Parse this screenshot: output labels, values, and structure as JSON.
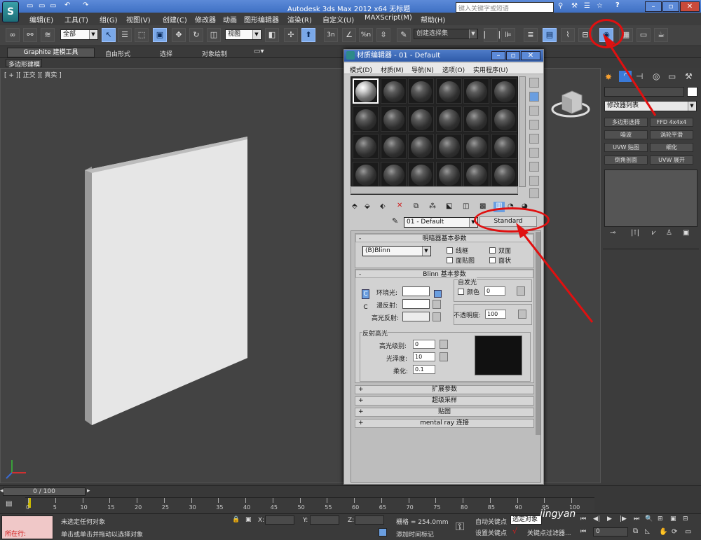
{
  "app": {
    "title": "Autodesk 3ds Max  2012 x64     无标题",
    "search_placeholder": "键入关键字或短语"
  },
  "menu": [
    "编辑(E)",
    "工具(T)",
    "组(G)",
    "视图(V)",
    "创建(C)",
    "修改器",
    "动画",
    "图形编辑器",
    "渲染(R)",
    "自定义(U)",
    "MAXScript(M)",
    "帮助(H)"
  ],
  "toolbar": {
    "selection_filter": "全部",
    "coord_system": "视图",
    "snap_label": "3n",
    "angle_label": "%n",
    "named_selection": "创建选择集"
  },
  "ribbon": {
    "tabs": [
      "Graphite 建模工具",
      "自由形式",
      "选择",
      "对象绘制"
    ],
    "sub_label": "多边形建模"
  },
  "viewport": {
    "label": "[ + ][ 正交 ][ 真实 ]"
  },
  "material_editor": {
    "title": "材质编辑器 - 01 - Default",
    "menu": [
      "模式(D)",
      "材质(M)",
      "导航(N)",
      "选项(O)",
      "实用程序(U)"
    ],
    "material_name": "01 - Default",
    "material_type": "Standard",
    "shader_rollout": {
      "title": "明暗器基本参数",
      "shader": "(B)Blinn",
      "options": [
        "线框",
        "双面",
        "面贴图",
        "面状"
      ]
    },
    "blinn_rollout": {
      "title": "Blinn 基本参数",
      "self_illum_title": "自发光",
      "self_illum_color_label": "颜色",
      "self_illum_value": "0",
      "ambient_label": "环境光:",
      "diffuse_label": "漫反射:",
      "specular_label": "高光反射:",
      "opacity_label": "不透明度:",
      "opacity_value": "100",
      "spec_title": "反射高光",
      "spec_level_label": "高光级别:",
      "spec_level_value": "0",
      "gloss_label": "光泽度:",
      "gloss_value": "10",
      "soften_label": "柔化:",
      "soften_value": "0.1"
    },
    "collapsed_rollouts": [
      "扩展参数",
      "超级采样",
      "贴图",
      "mental ray 连接"
    ],
    "lock_icon": "C",
    "lock_icon2": "C"
  },
  "command_panel": {
    "modifier_list": "修改器列表",
    "buttons": [
      "多边形选择",
      "FFD 4x4x4",
      "噪波",
      "涡轮平滑",
      "UVW 贴图",
      "细化",
      "倒角剖面",
      "UVW 展开"
    ]
  },
  "timeline": {
    "frame_counter": "0 / 100",
    "ticks": [
      "0",
      "5",
      "10",
      "15",
      "20",
      "25",
      "30",
      "35",
      "40",
      "45",
      "50",
      "55",
      "60",
      "65",
      "70",
      "75",
      "80",
      "85",
      "90",
      "95",
      "100"
    ]
  },
  "status": {
    "maxscript": "所在行:",
    "prompt1": "未选定任何对象",
    "prompt2": "单击或单击并拖动以选择对象",
    "x_label": "X:",
    "y_label": "Y:",
    "z_label": "Z:",
    "grid": "栅格 = 254.0mm",
    "add_time_tag": "添加时间标记",
    "auto_key": "自动关键点",
    "selected": "选定对象",
    "set_key": "设置关键点",
    "key_filters": "关键点过滤器...",
    "frame": "0",
    "watermark": "jingyan"
  }
}
